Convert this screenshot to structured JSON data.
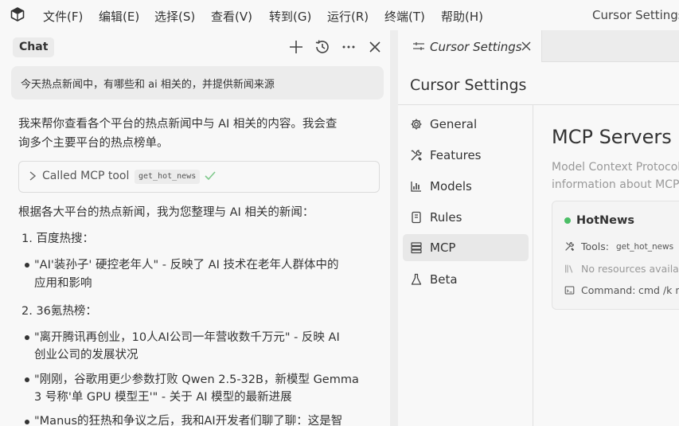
{
  "menubar": {
    "items": [
      "文件(F)",
      "编辑(E)",
      "选择(S)",
      "查看(V)",
      "转到(G)",
      "运行(R)",
      "终端(T)",
      "帮助(H)"
    ],
    "window_title": "Cursor Settings -"
  },
  "chat": {
    "tab_label": "Chat",
    "icons": [
      "plus-icon",
      "history-icon",
      "more-icon",
      "close-icon"
    ],
    "user_prompt": "今天热点新闻中，有哪些和 ai 相关的，并提供新闻来源",
    "intro": [
      "我来帮你查看各个平台的热点新闻中与 AI 相关的内容。我会查",
      "询多个主要平台的热点榜单。"
    ],
    "tool_call": {
      "label": "Called MCP tool",
      "tool_name": "get_hot_news",
      "status": "success"
    },
    "summary": "根据各大平台的热点新闻，我为您整理与 AI 相关的新闻：",
    "sections": [
      {
        "heading": "1. 百度热搜：",
        "bullets": [
          [
            "\"AI'装孙子' 硬控老年人\" - 反映了 AI 技术在老年人群体中的",
            "应用和影响"
          ]
        ]
      },
      {
        "heading": "2. 36氪热榜：",
        "bullets": [
          [
            "\"离开腾讯再创业，10人AI公司一年营收数千万元\" - 反映 AI",
            "创业公司的发展状况"
          ],
          [
            "\"刚刚，谷歌用更少参数打败 Qwen 2.5-32B，新模型 Gemma",
            "3 号称'单 GPU 模型王'\" - 关于 AI 模型的最新进展"
          ],
          [
            "\"Manus的狂热和争议之后，我和AI开发者们聊了聊：这是智"
          ]
        ]
      }
    ]
  },
  "settings": {
    "tab_label": "Cursor Settings",
    "title": "Cursor Settings",
    "nav": [
      {
        "label": "General",
        "icon": "gear-icon",
        "active": false
      },
      {
        "label": "Features",
        "icon": "tools-icon",
        "active": false
      },
      {
        "label": "Models",
        "icon": "chart-icon",
        "active": false
      },
      {
        "label": "Rules",
        "icon": "rules-icon",
        "active": false
      },
      {
        "label": "MCP",
        "icon": "server-icon",
        "active": true
      },
      {
        "label": "Beta",
        "icon": "flask-icon",
        "active": false
      }
    ],
    "mcp": {
      "heading": "MCP Servers",
      "description": [
        "Model Context Protocol",
        "information about MCP"
      ],
      "server": {
        "name": "HotNews",
        "status": "enabled",
        "status_color": "#4bbe66",
        "tools_label": "Tools:",
        "tools_value": "get_hot_news",
        "resources_text": "No resources available",
        "command_label": "Command:",
        "command_value": "cmd /k np"
      }
    }
  }
}
